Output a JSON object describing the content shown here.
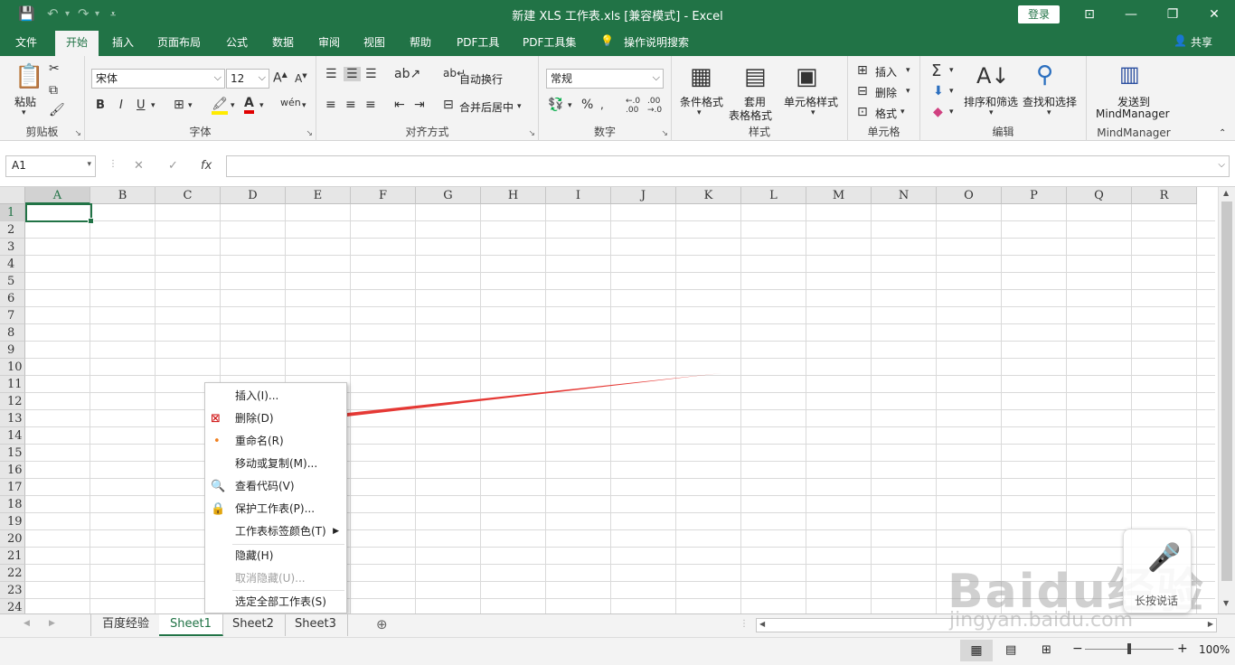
{
  "titlebar": {
    "title": "新建 XLS 工作表.xls  [兼容模式]  -  Excel",
    "login": "登录",
    "qa_icons": [
      "save-icon",
      "undo-icon",
      "redo-icon",
      "customize-icon"
    ]
  },
  "tabs": [
    "文件",
    "开始",
    "插入",
    "页面布局",
    "公式",
    "数据",
    "审阅",
    "视图",
    "帮助",
    "PDF工具",
    "PDF工具集",
    "操作说明搜索"
  ],
  "share": "共享",
  "ribbon": {
    "clipboard": {
      "label": "剪贴板",
      "paste": "粘贴"
    },
    "font": {
      "label": "字体",
      "name": "宋体",
      "size": "12",
      "bold": "B",
      "italic": "I",
      "underline": "U"
    },
    "align": {
      "label": "对齐方式",
      "wrap": "自动换行",
      "merge": "合并后居中"
    },
    "number": {
      "label": "数字",
      "format": "常规",
      "percent": "%"
    },
    "styles": {
      "label": "样式",
      "cond": "条件格式",
      "table1": "套用",
      "table2": "表格格式",
      "cell": "单元格样式"
    },
    "cells": {
      "label": "单元格",
      "insert": "插入",
      "delete": "删除",
      "format": "格式"
    },
    "editing": {
      "label": "编辑",
      "sort": "排序和筛选",
      "find": "查找和选择"
    },
    "mm": {
      "label": "MindManager",
      "send1": "发送到",
      "send2": "MindManager"
    }
  },
  "formula": {
    "namebox": "A1",
    "fx": "fx"
  },
  "columns": [
    "A",
    "B",
    "C",
    "D",
    "E",
    "F",
    "G",
    "H",
    "I",
    "J",
    "K",
    "L",
    "M",
    "N",
    "O",
    "P",
    "Q",
    "R"
  ],
  "rows": [
    "1",
    "2",
    "3",
    "4",
    "5",
    "6",
    "7",
    "8",
    "9",
    "10",
    "11",
    "12",
    "13",
    "14",
    "15",
    "16",
    "17",
    "18",
    "19",
    "20",
    "21",
    "22",
    "23",
    "24"
  ],
  "context_menu": [
    {
      "label": "插入(I)...",
      "icon": "",
      "disabled": false
    },
    {
      "label": "删除(D)",
      "icon": "delete-sheet-icon",
      "disabled": false
    },
    {
      "label": "重命名(R)",
      "icon": "dot-icon",
      "disabled": false
    },
    {
      "label": "移动或复制(M)...",
      "icon": "",
      "disabled": false
    },
    {
      "label": "查看代码(V)",
      "icon": "view-code-icon",
      "disabled": false
    },
    {
      "label": "保护工作表(P)...",
      "icon": "protect-sheet-icon",
      "disabled": false
    },
    {
      "label": "工作表标签颜色(T)",
      "icon": "",
      "disabled": false
    },
    {
      "label": "隐藏(H)",
      "icon": "",
      "disabled": false
    },
    {
      "label": "取消隐藏(U)...",
      "icon": "",
      "disabled": true
    },
    {
      "label": "选定全部工作表(S)",
      "icon": "",
      "disabled": false
    }
  ],
  "sheets": [
    "百度经验",
    "Sheet1",
    "Sheet2",
    "Sheet3"
  ],
  "status": {
    "zoom": "100%"
  },
  "watermark": {
    "brand": "Baidu经验",
    "url": "jingyan.baidu.com",
    "voice": "长按说话"
  },
  "colors": {
    "excel_green": "#217346",
    "arrow_red": "#e53935"
  }
}
